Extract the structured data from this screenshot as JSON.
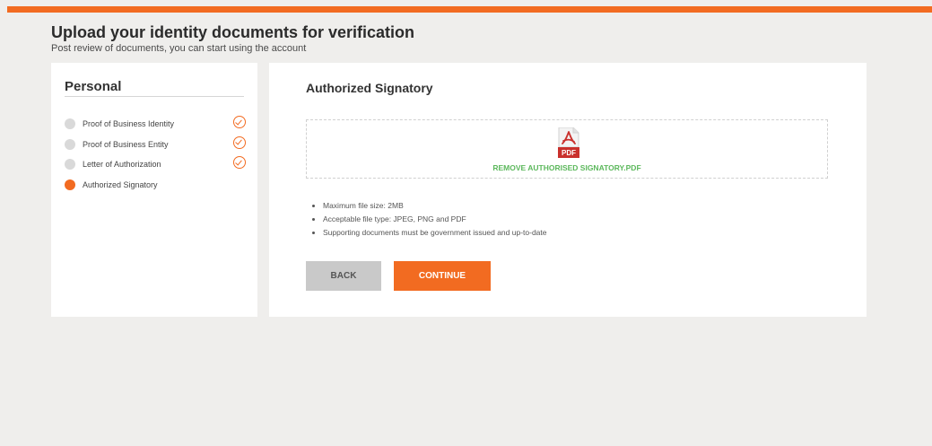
{
  "header": {
    "title": "Upload your identity documents for verification",
    "subtitle": "Post review of documents, you can start using the account"
  },
  "sidebar": {
    "title": "Personal",
    "steps": [
      {
        "label": "Proof of Business Identity",
        "status": "completed"
      },
      {
        "label": "Proof of Business Entity",
        "status": "completed"
      },
      {
        "label": "Letter of Authorization",
        "status": "completed"
      },
      {
        "label": "Authorized Signatory",
        "status": "active"
      }
    ]
  },
  "main": {
    "title": "Authorized Signatory",
    "upload": {
      "file_icon": "pdf-file-icon",
      "icon_text": "PDF",
      "remove_label": "REMOVE AUTHORISED SIGNATORY.PDF"
    },
    "rules": [
      "Maximum file size: 2MB",
      "Acceptable file type: JPEG, PNG and PDF",
      "Supporting documents must be government issued and up-to-date"
    ],
    "back_label": "BACK",
    "continue_label": "CONTINUE"
  },
  "colors": {
    "accent": "#f26b21",
    "success": "#5cb85c",
    "pdf_red": "#c9302c"
  }
}
